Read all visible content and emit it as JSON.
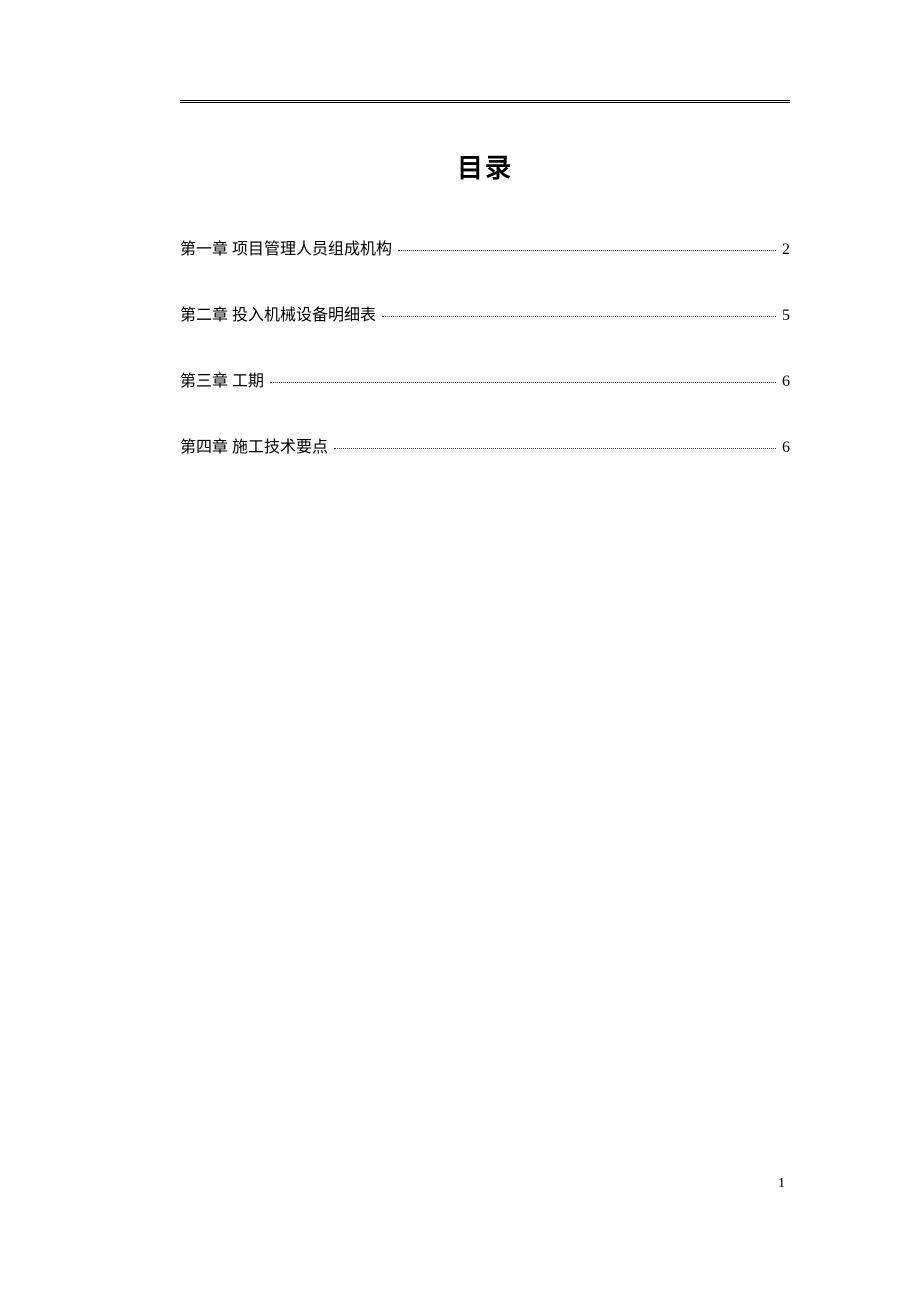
{
  "title": "目录",
  "toc": {
    "entries": [
      {
        "label": "第一章 项目管理人员组成机构",
        "page": "2"
      },
      {
        "label": "第二章 投入机械设备明细表",
        "page": "5"
      },
      {
        "label": "第三章 工期",
        "page": "6"
      },
      {
        "label": "第四章 施工技术要点",
        "page": "6"
      }
    ]
  },
  "page_number": "1"
}
